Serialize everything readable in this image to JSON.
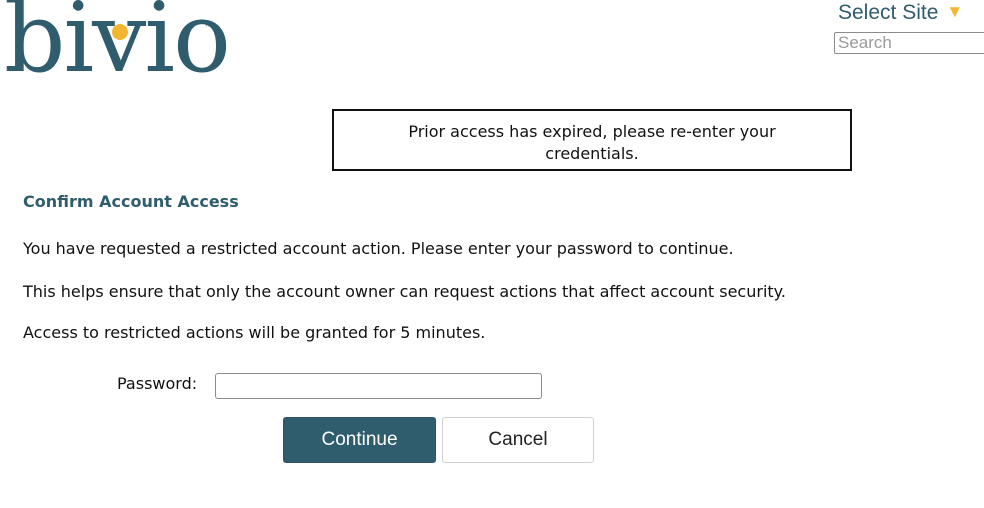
{
  "logo": {
    "text": "bivio",
    "trademark": "™"
  },
  "header": {
    "site_select_label": "Select Site",
    "site_select_arrow": "▼",
    "search_placeholder": "Search"
  },
  "alert": {
    "message": "Prior access has expired, please re-enter your credentials."
  },
  "main": {
    "heading": "Confirm Account Access",
    "paragraphs": [
      "You have requested a restricted account action. Please enter your password to continue.",
      "This helps ensure that only the account owner can request actions that affect account security.",
      "Access to restricted actions will be granted for 5 minutes."
    ]
  },
  "form": {
    "password_label": "Password:",
    "password_value": "",
    "continue_label": "Continue",
    "cancel_label": "Cancel"
  },
  "colors": {
    "brand": "#2f5d6e",
    "accent": "#f2b632"
  }
}
